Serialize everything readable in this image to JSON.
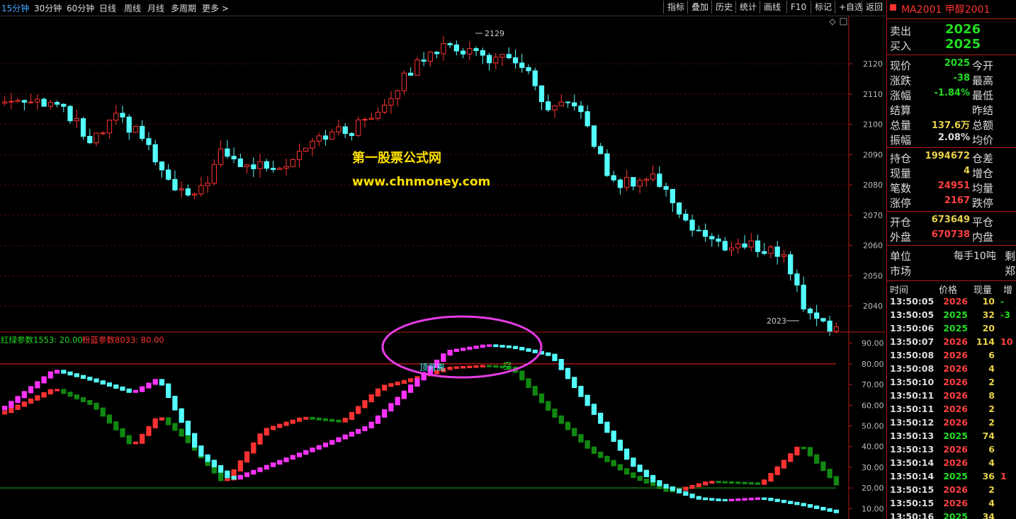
{
  "timeframes": [
    "15分钟",
    "30分钟",
    "60分钟",
    "日线",
    "周线",
    "月线",
    "多周期",
    "更多 >"
  ],
  "toolbar": [
    "指标",
    "叠加",
    "历史",
    "统计",
    "画线",
    "F10",
    "标记",
    "+自选",
    "返回"
  ],
  "watermark": {
    "line1": "第一股票公式网",
    "line2": "www.chnmoney.com"
  },
  "price_axis": [
    "2120",
    "2110",
    "2100",
    "2090",
    "2080",
    "2070",
    "2060",
    "2050",
    "2040"
  ],
  "price_markers": {
    "high": "2129",
    "low": "2023"
  },
  "indicator_title": {
    "green": "红绿参数1553: 20.00",
    "red": "粉蓝参数8033: 80.00"
  },
  "indicator_axis": [
    "90.00",
    "80.00",
    "70.00",
    "60.00",
    "50.00",
    "40.00",
    "30.00",
    "20.00",
    "10.00"
  ],
  "annotations": {
    "divergence": "顶背离",
    "short": "空"
  },
  "colors": {
    "up": "#ff3232",
    "down": "#54ffff",
    "magenta": "#ff33ff",
    "red_line": "#ff2020",
    "green_line": "#118811",
    "accent": "#ff3232",
    "green_text": "#22dd22",
    "yellow": "#e8d34a"
  },
  "quote": {
    "symbol": "MA2001 甲醇2001",
    "sell_label": "卖出",
    "sell_value": "2026",
    "buy_label": "买入",
    "buy_value": "2025",
    "rows_a": [
      {
        "label": "现价",
        "value": "2025",
        "label2": "今开",
        "color": "#22dd22"
      },
      {
        "label": "涨跌",
        "value": "-38",
        "label2": "最高",
        "color": "#22dd22"
      },
      {
        "label": "涨幅",
        "value": "-1.84%",
        "label2": "最低",
        "color": "#22dd22"
      },
      {
        "label": "结算",
        "value": "",
        "label2": "昨结",
        "color": "#ddd"
      },
      {
        "label": "总量",
        "value": "137.6万",
        "label2": "总额",
        "color": "#e8d34a"
      },
      {
        "label": "振幅",
        "value": "2.08%",
        "label2": "均价",
        "color": "#ddd"
      }
    ],
    "rows_b": [
      {
        "label": "持仓",
        "value": "1994672",
        "label2": "仓差",
        "color": "#e8d34a"
      },
      {
        "label": "现量",
        "value": "4",
        "label2": "增仓",
        "color": "#e8d34a"
      },
      {
        "label": "笔数",
        "value": "24951",
        "label2": "均量",
        "color": "#ff4040"
      },
      {
        "label": "涨停",
        "value": "2167",
        "label2": "跌停",
        "color": "#ff4040"
      }
    ],
    "rows_c": [
      {
        "label": "开仓",
        "value": "673649",
        "label2": "平仓",
        "color": "#e8d34a"
      },
      {
        "label": "外盘",
        "value": "670738",
        "label2": "内盘",
        "color": "#ff4040"
      }
    ],
    "unit_label": "单位",
    "unit_value": "每手10吨",
    "unit_extra": "剩",
    "market_label": "市场",
    "market_value": "",
    "market_extra": "郑",
    "ticks_header": [
      "时间",
      "价格",
      "现量",
      "增"
    ],
    "ticks": [
      {
        "time": "13:50:05",
        "price": "2026",
        "vol": "10",
        "extra": "-",
        "pc": "#ff4040"
      },
      {
        "time": "13:50:05",
        "price": "2025",
        "vol": "32",
        "extra": "-3",
        "pc": "#22dd22"
      },
      {
        "time": "13:50:06",
        "price": "2025",
        "vol": "20",
        "extra": "",
        "pc": "#22dd22"
      },
      {
        "time": "13:50:07",
        "price": "2026",
        "vol": "114",
        "extra": "10",
        "pc": "#ff4040"
      },
      {
        "time": "13:50:08",
        "price": "2026",
        "vol": "6",
        "extra": "",
        "pc": "#ff4040"
      },
      {
        "time": "13:50:08",
        "price": "2026",
        "vol": "4",
        "extra": "",
        "pc": "#ff4040"
      },
      {
        "time": "13:50:10",
        "price": "2026",
        "vol": "2",
        "extra": "",
        "pc": "#ff4040"
      },
      {
        "time": "13:50:11",
        "price": "2026",
        "vol": "8",
        "extra": "",
        "pc": "#ff4040"
      },
      {
        "time": "13:50:11",
        "price": "2026",
        "vol": "2",
        "extra": "",
        "pc": "#ff4040"
      },
      {
        "time": "13:50:12",
        "price": "2026",
        "vol": "2",
        "extra": "",
        "pc": "#ff4040"
      },
      {
        "time": "13:50:13",
        "price": "2025",
        "vol": "74",
        "extra": "",
        "pc": "#22dd22"
      },
      {
        "time": "13:50:13",
        "price": "2026",
        "vol": "6",
        "extra": "",
        "pc": "#ff4040"
      },
      {
        "time": "13:50:14",
        "price": "2026",
        "vol": "4",
        "extra": "",
        "pc": "#ff4040"
      },
      {
        "time": "13:50:14",
        "price": "2025",
        "vol": "36",
        "extra": "1",
        "pc": "#22dd22"
      },
      {
        "time": "13:50:15",
        "price": "2026",
        "vol": "2",
        "extra": "",
        "pc": "#ff4040"
      },
      {
        "time": "13:50:15",
        "price": "2026",
        "vol": "4",
        "extra": "",
        "pc": "#ff4040"
      },
      {
        "time": "13:50:16",
        "price": "2025",
        "vol": "34",
        "extra": "",
        "pc": "#22dd22"
      }
    ]
  },
  "chart_data": {
    "type": "line",
    "price_candles": {
      "ylim": [
        2033,
        2135
      ],
      "count": 128,
      "keypoints": [
        [
          0,
          2107
        ],
        [
          5,
          2109
        ],
        [
          9,
          2106
        ],
        [
          12,
          2100
        ],
        [
          14,
          2093
        ],
        [
          18,
          2102
        ],
        [
          22,
          2096
        ],
        [
          26,
          2080
        ],
        [
          30,
          2075
        ],
        [
          34,
          2090
        ],
        [
          38,
          2086
        ],
        [
          44,
          2087
        ],
        [
          48,
          2096
        ],
        [
          54,
          2098
        ],
        [
          58,
          2105
        ],
        [
          62,
          2115
        ],
        [
          66,
          2125
        ],
        [
          71,
          2125
        ],
        [
          75,
          2122
        ],
        [
          80,
          2120
        ],
        [
          84,
          2103
        ],
        [
          88,
          2108
        ],
        [
          90,
          2098
        ],
        [
          94,
          2080
        ],
        [
          100,
          2083
        ],
        [
          106,
          2066
        ],
        [
          110,
          2060
        ],
        [
          115,
          2060
        ],
        [
          120,
          2057
        ],
        [
          123,
          2040
        ],
        [
          128,
          2032
        ]
      ]
    },
    "indicator": {
      "ylim": [
        5,
        95
      ],
      "lines_at": [
        80,
        20
      ],
      "pink_blue_keypoints": [
        [
          0,
          58
        ],
        [
          8,
          77
        ],
        [
          14,
          72
        ],
        [
          20,
          66
        ],
        [
          24,
          73
        ],
        [
          30,
          37
        ],
        [
          35,
          24
        ],
        [
          40,
          30
        ],
        [
          45,
          36
        ],
        [
          50,
          42
        ],
        [
          56,
          50
        ],
        [
          62,
          68
        ],
        [
          68,
          86
        ],
        [
          74,
          89
        ],
        [
          78,
          88
        ],
        [
          84,
          84
        ],
        [
          90,
          58
        ],
        [
          96,
          32
        ],
        [
          100,
          22
        ],
        [
          106,
          15
        ],
        [
          110,
          14
        ],
        [
          116,
          15
        ],
        [
          122,
          12
        ],
        [
          128,
          8
        ]
      ],
      "red_green_keypoints": [
        [
          0,
          56
        ],
        [
          8,
          68
        ],
        [
          14,
          60
        ],
        [
          20,
          40
        ],
        [
          24,
          55
        ],
        [
          28,
          44
        ],
        [
          34,
          22
        ],
        [
          40,
          48
        ],
        [
          46,
          54
        ],
        [
          52,
          52
        ],
        [
          58,
          69
        ],
        [
          62,
          72
        ],
        [
          68,
          78
        ],
        [
          74,
          79
        ],
        [
          78,
          78
        ],
        [
          84,
          56
        ],
        [
          90,
          38
        ],
        [
          96,
          26
        ],
        [
          102,
          18
        ],
        [
          108,
          23
        ],
        [
          116,
          22
        ],
        [
          122,
          41
        ],
        [
          128,
          20
        ]
      ]
    }
  }
}
